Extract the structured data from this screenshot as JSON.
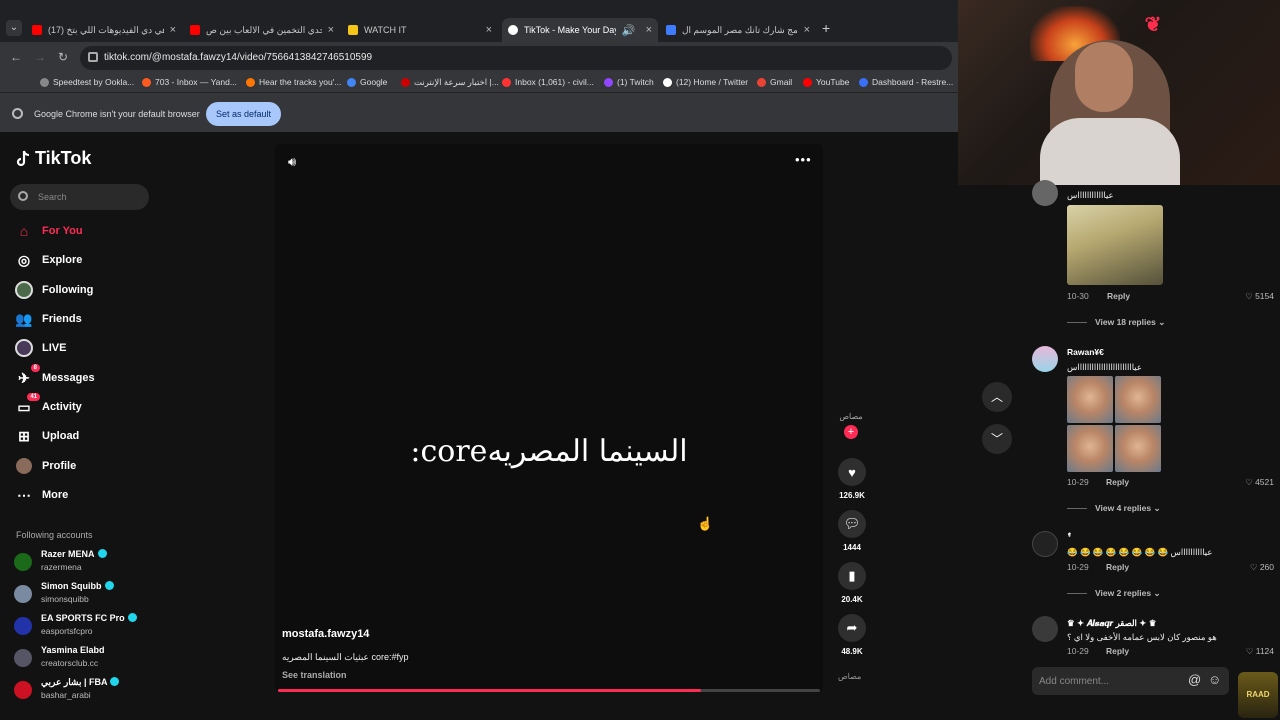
{
  "browser": {
    "tabs": [
      {
        "title": "(17) هي دي الفيديوهات اللي بتخ...",
        "favicon_color": "#ff0000"
      },
      {
        "title": "تحدي التخمين في الالعاب بين ص...",
        "favicon_color": "#ff0000"
      },
      {
        "title": "WATCH IT",
        "favicon_color": "#f5c518"
      },
      {
        "title": "TikTok - Make Your Day",
        "favicon_color": "#ffffff"
      },
      {
        "title": "برنامج شارك تانك مصر الموسم ال...",
        "favicon_color": "#3f7bff"
      }
    ],
    "new_tab": "+",
    "url": "tiktok.com/@mostafa.fawzy14/video/7566413842746510599",
    "bookmarks": [
      {
        "label": "Speedtest by Ookla...",
        "color": "#888888"
      },
      {
        "label": "703 - Inbox — Yand...",
        "color": "#ff5a1f"
      },
      {
        "label": "Hear the tracks you'...",
        "color": "#ff7700"
      },
      {
        "label": "Google",
        "color": "#4285f4"
      },
      {
        "label": "اختبار سرعة الإنترنت |...",
        "color": "#cc0000"
      },
      {
        "label": "Inbox (1,061) - civil...",
        "color": "#ff3333"
      },
      {
        "label": "(1) Twitch",
        "color": "#9146ff"
      },
      {
        "label": "(12) Home / Twitter",
        "color": "#ffffff"
      },
      {
        "label": "Gmail",
        "color": "#ea4335"
      },
      {
        "label": "YouTube",
        "color": "#ff0000"
      },
      {
        "label": "Dashboard - Restre...",
        "color": "#3a6ff7"
      }
    ],
    "infobar": {
      "message": "Google Chrome isn't your default browser",
      "button": "Set as default"
    }
  },
  "sidebar": {
    "logo": "TikTok",
    "search_placeholder": "Search",
    "items": [
      {
        "label": "For You",
        "icon": "home-icon"
      },
      {
        "label": "Explore",
        "icon": "compass-icon"
      },
      {
        "label": "Following",
        "icon": "following-icon"
      },
      {
        "label": "Friends",
        "icon": "friends-icon"
      },
      {
        "label": "LIVE",
        "icon": "live-icon"
      },
      {
        "label": "Messages",
        "icon": "messages-icon",
        "badge": "8"
      },
      {
        "label": "Activity",
        "icon": "activity-icon",
        "badge": "41"
      },
      {
        "label": "Upload",
        "icon": "upload-icon"
      },
      {
        "label": "Profile",
        "icon": "profile-icon"
      },
      {
        "label": "More",
        "icon": "more-icon"
      }
    ],
    "following_title": "Following accounts",
    "accounts": [
      {
        "name": "Razer MENA",
        "handle": "razermena",
        "verified": true,
        "color": "#1a6a1a"
      },
      {
        "name": "Simon Squibb",
        "handle": "simonsquibb",
        "verified": true,
        "color": "#7a8aa0"
      },
      {
        "name": "EA SPORTS FC Pro",
        "handle": "easportsfcpro",
        "verified": true,
        "color": "#2233aa"
      },
      {
        "name": "Yasmina Elabd",
        "handle": "creatorsclub.cc",
        "verified": false,
        "color": "#555566"
      },
      {
        "name": "بشار عربي | FBA",
        "handle": "bashar_arabi",
        "verified": true,
        "color": "#cc1122"
      }
    ]
  },
  "video": {
    "caption": "السينما المصريهcore:",
    "author": "mostafa.fawzy14",
    "description": "عبثيات السينما المصريه core:#fyp",
    "see_translation": "See translation",
    "progress": 0.78,
    "avatar_label": "مصاص",
    "music_label": "مصاص",
    "likes": "126.9K",
    "comments": "1444",
    "saves": "20.4K",
    "shares": "48.9K"
  },
  "comments": {
    "items": [
      {
        "name": "",
        "text": "عيااااااااااااس",
        "date": "10-30",
        "reply": "Reply",
        "likes": "5154",
        "view_replies": "View 18 replies"
      },
      {
        "name": "Rawan¥€",
        "text": "عيااااااااااااااااااااااااس",
        "date": "10-29",
        "reply": "Reply",
        "likes": "4521",
        "view_replies": "View 4 replies"
      },
      {
        "name": "ٌ٘ٛ",
        "text": "عيااااااااااس 😂 😂 😂 😂 😂 😂 😂 😂",
        "date": "10-29",
        "reply": "Reply",
        "likes": "260",
        "view_replies": "View 2 replies"
      },
      {
        "name": "♛ ✦ 𝑨𝒍𝒔𝒂𝒒𝒓 الصقر ✦ ♛",
        "text": "هو منصور كان لابس عمامه الأخفى ولا اي ؟",
        "date": "10-29",
        "reply": "Reply",
        "likes": "1124"
      }
    ],
    "add_placeholder": "Add comment...",
    "at_symbol": "@",
    "emoji_symbol": "☺"
  },
  "overlay": {
    "badge_text": "RAAD"
  },
  "colors": {
    "accent": "#fe2c55",
    "bg": "#121212",
    "verified": "#20d5ec"
  }
}
